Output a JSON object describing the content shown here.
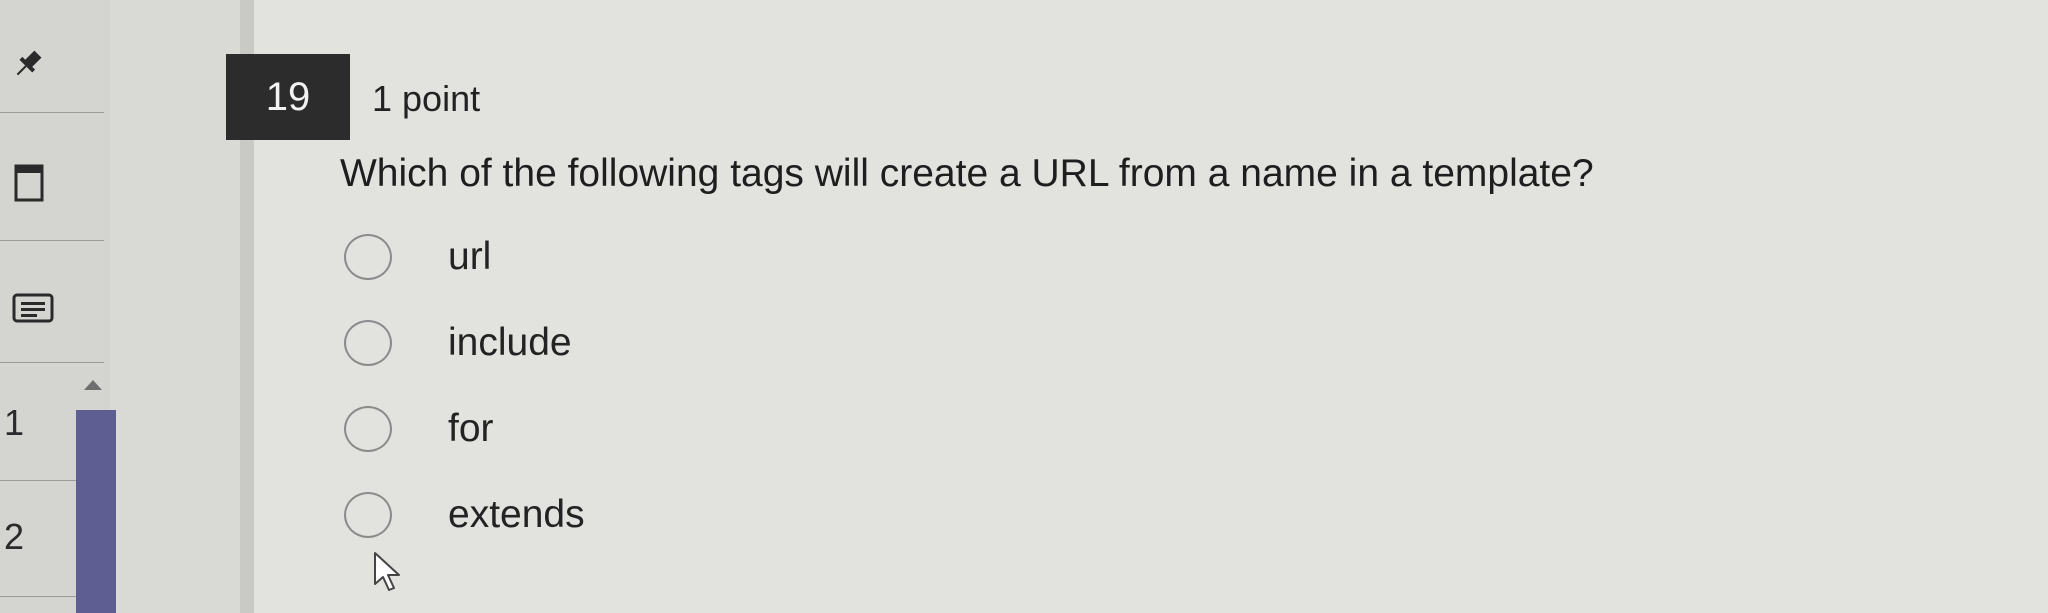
{
  "nav": {
    "items": [
      {
        "icon": "pin-icon"
      },
      {
        "icon": "window-icon"
      },
      {
        "icon": "list-icon"
      }
    ],
    "question_numbers": [
      "1",
      "2"
    ]
  },
  "question": {
    "number": "19",
    "points": "1 point",
    "text": "Which of the following tags will create  a URL from a name in a template?",
    "options": [
      "url",
      "include",
      "for",
      "extends"
    ]
  },
  "colors": {
    "background": "#e2e2df",
    "question_badge": "#2c2c2c",
    "scrollbar": "#5f5e92"
  }
}
